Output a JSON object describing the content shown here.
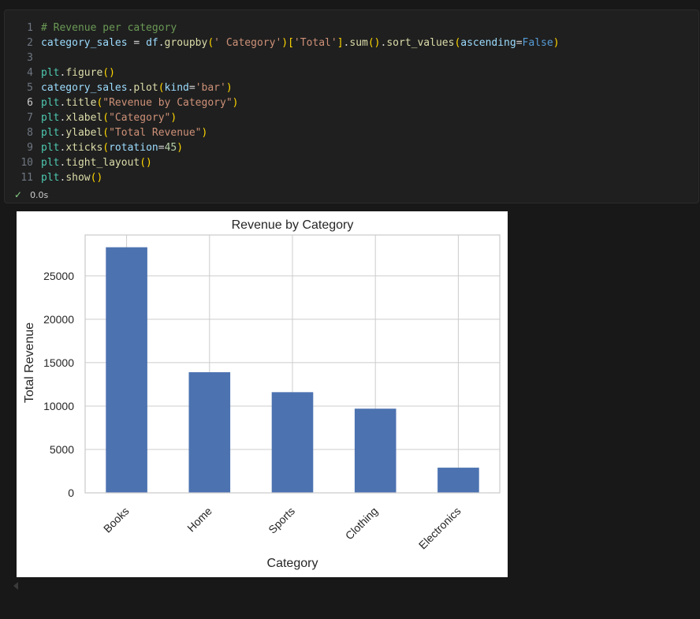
{
  "cell": {
    "lines": [
      {
        "n": "1",
        "tokens": [
          {
            "t": "# Revenue per category",
            "c": "t-comment"
          }
        ]
      },
      {
        "n": "2",
        "tokens": [
          {
            "t": "category_sales",
            "c": "t-var"
          },
          {
            "t": " = ",
            "c": "t-op"
          },
          {
            "t": "df",
            "c": "t-var"
          },
          {
            "t": ".",
            "c": "t-op"
          },
          {
            "t": "groupby",
            "c": "t-fn"
          },
          {
            "t": "(",
            "c": "t-br1"
          },
          {
            "t": "' Category'",
            "c": "t-str"
          },
          {
            "t": ")",
            "c": "t-br1"
          },
          {
            "t": "[",
            "c": "t-br1"
          },
          {
            "t": "'Total'",
            "c": "t-str"
          },
          {
            "t": "]",
            "c": "t-br1"
          },
          {
            "t": ".",
            "c": "t-op"
          },
          {
            "t": "sum",
            "c": "t-fn"
          },
          {
            "t": "()",
            "c": "t-br1"
          },
          {
            "t": ".",
            "c": "t-op"
          },
          {
            "t": "sort_values",
            "c": "t-fn"
          },
          {
            "t": "(",
            "c": "t-br1"
          },
          {
            "t": "ascending",
            "c": "t-var"
          },
          {
            "t": "=",
            "c": "t-op"
          },
          {
            "t": "False",
            "c": "t-kw"
          },
          {
            "t": ")",
            "c": "t-br1"
          }
        ]
      },
      {
        "n": "3",
        "tokens": []
      },
      {
        "n": "4",
        "tokens": [
          {
            "t": "plt",
            "c": "t-mod"
          },
          {
            "t": ".",
            "c": "t-op"
          },
          {
            "t": "figure",
            "c": "t-fn"
          },
          {
            "t": "()",
            "c": "t-br1"
          }
        ]
      },
      {
        "n": "5",
        "tokens": [
          {
            "t": "category_sales",
            "c": "t-var"
          },
          {
            "t": ".",
            "c": "t-op"
          },
          {
            "t": "plot",
            "c": "t-fn"
          },
          {
            "t": "(",
            "c": "t-br1"
          },
          {
            "t": "kind",
            "c": "t-var"
          },
          {
            "t": "=",
            "c": "t-op"
          },
          {
            "t": "'bar'",
            "c": "t-str"
          },
          {
            "t": ")",
            "c": "t-br1"
          }
        ]
      },
      {
        "n": "6",
        "active": true,
        "tokens": [
          {
            "t": "plt",
            "c": "t-mod"
          },
          {
            "t": ".",
            "c": "t-op"
          },
          {
            "t": "title",
            "c": "t-fn"
          },
          {
            "t": "(",
            "c": "t-br1"
          },
          {
            "t": "\"Revenue by Category\"",
            "c": "t-str"
          },
          {
            "t": ")",
            "c": "t-br1"
          }
        ]
      },
      {
        "n": "7",
        "tokens": [
          {
            "t": "plt",
            "c": "t-mod"
          },
          {
            "t": ".",
            "c": "t-op"
          },
          {
            "t": "xlabel",
            "c": "t-fn"
          },
          {
            "t": "(",
            "c": "t-br1"
          },
          {
            "t": "\"Category\"",
            "c": "t-str"
          },
          {
            "t": ")",
            "c": "t-br1"
          }
        ]
      },
      {
        "n": "8",
        "tokens": [
          {
            "t": "plt",
            "c": "t-mod"
          },
          {
            "t": ".",
            "c": "t-op"
          },
          {
            "t": "ylabel",
            "c": "t-fn"
          },
          {
            "t": "(",
            "c": "t-br1"
          },
          {
            "t": "\"Total Revenue\"",
            "c": "t-str"
          },
          {
            "t": ")",
            "c": "t-br1"
          }
        ]
      },
      {
        "n": "9",
        "tokens": [
          {
            "t": "plt",
            "c": "t-mod"
          },
          {
            "t": ".",
            "c": "t-op"
          },
          {
            "t": "xticks",
            "c": "t-fn"
          },
          {
            "t": "(",
            "c": "t-br1"
          },
          {
            "t": "rotation",
            "c": "t-var"
          },
          {
            "t": "=",
            "c": "t-op"
          },
          {
            "t": "45",
            "c": "t-num"
          },
          {
            "t": ")",
            "c": "t-br1"
          }
        ]
      },
      {
        "n": "10",
        "tokens": [
          {
            "t": "plt",
            "c": "t-mod"
          },
          {
            "t": ".",
            "c": "t-op"
          },
          {
            "t": "tight_layout",
            "c": "t-fn"
          },
          {
            "t": "()",
            "c": "t-br1"
          }
        ]
      },
      {
        "n": "11",
        "tokens": [
          {
            "t": "plt",
            "c": "t-mod"
          },
          {
            "t": ".",
            "c": "t-op"
          },
          {
            "t": "show",
            "c": "t-fn"
          },
          {
            "t": "()",
            "c": "t-br1"
          }
        ]
      }
    ],
    "status": {
      "icon": "check-icon",
      "time": "0.0s"
    }
  },
  "colors": {
    "bar": "#4c72b0",
    "grid": "#cccccc",
    "success": "#89d185"
  },
  "chart_data": {
    "type": "bar",
    "title": "Revenue by Category",
    "xlabel": "Category",
    "ylabel": "Total Revenue",
    "categories": [
      "Books",
      "Home",
      "Sports",
      "Clothing",
      "Electronics"
    ],
    "values": [
      28300,
      13900,
      11600,
      9700,
      2900
    ],
    "yticks": [
      0,
      5000,
      10000,
      15000,
      20000,
      25000
    ],
    "ylim": [
      0,
      29715
    ],
    "grid": true,
    "xtick_rotation": 45
  }
}
